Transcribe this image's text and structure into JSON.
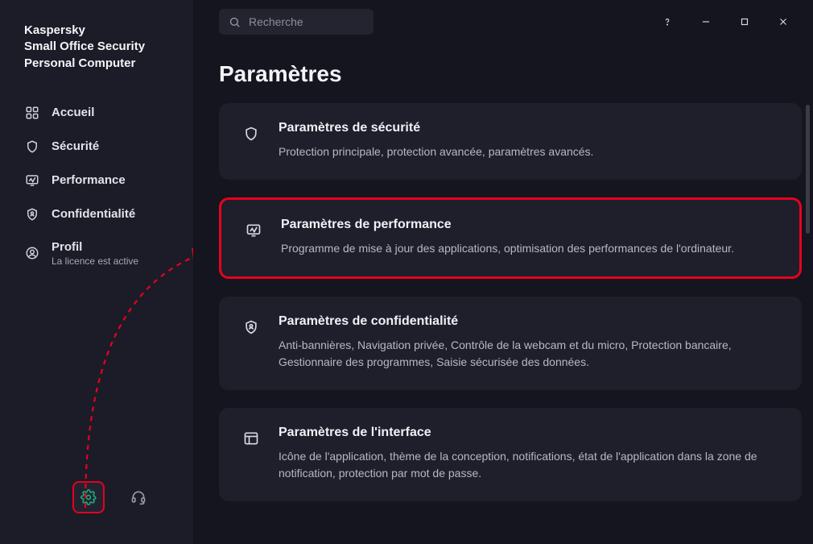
{
  "brand": {
    "line1": "Kaspersky",
    "line2": "Small Office Security",
    "line3": "Personal Computer"
  },
  "search": {
    "placeholder": "Recherche"
  },
  "page": {
    "title": "Paramètres"
  },
  "sidebar": {
    "items": [
      {
        "label": "Accueil"
      },
      {
        "label": "Sécurité"
      },
      {
        "label": "Performance"
      },
      {
        "label": "Confidentialité"
      },
      {
        "label": "Profil",
        "sub": "La licence est active"
      }
    ]
  },
  "cards": [
    {
      "title": "Paramètres de sécurité",
      "desc": "Protection principale, protection avancée, paramètres avancés."
    },
    {
      "title": "Paramètres de performance",
      "desc": "Programme de mise à jour des applications, optimisation des performances de l'ordinateur."
    },
    {
      "title": "Paramètres de confidentialité",
      "desc": "Anti-bannières, Navigation privée, Contrôle de la webcam et du micro, Protection bancaire, Gestionnaire des programmes, Saisie sécurisée des données."
    },
    {
      "title": "Paramètres de l'interface",
      "desc": "Icône de l'application, thème de la conception, notifications, état de l'application dans la zone de notification, protection par mot de passe."
    }
  ]
}
